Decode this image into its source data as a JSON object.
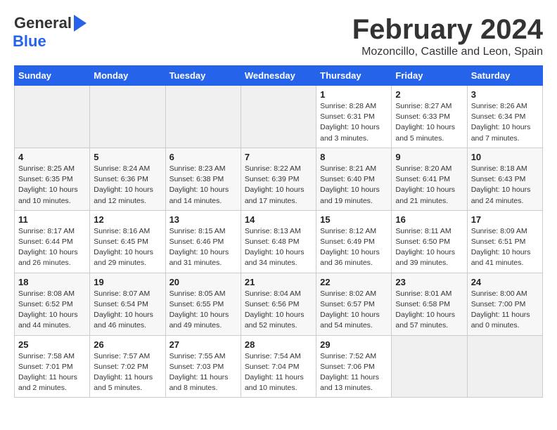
{
  "header": {
    "logo_general": "General",
    "logo_blue": "Blue",
    "month_title": "February 2024",
    "location": "Mozoncillo, Castille and Leon, Spain"
  },
  "days_of_week": [
    "Sunday",
    "Monday",
    "Tuesday",
    "Wednesday",
    "Thursday",
    "Friday",
    "Saturday"
  ],
  "weeks": [
    [
      {
        "day": "",
        "info": ""
      },
      {
        "day": "",
        "info": ""
      },
      {
        "day": "",
        "info": ""
      },
      {
        "day": "",
        "info": ""
      },
      {
        "day": "1",
        "info": "Sunrise: 8:28 AM\nSunset: 6:31 PM\nDaylight: 10 hours\nand 3 minutes."
      },
      {
        "day": "2",
        "info": "Sunrise: 8:27 AM\nSunset: 6:33 PM\nDaylight: 10 hours\nand 5 minutes."
      },
      {
        "day": "3",
        "info": "Sunrise: 8:26 AM\nSunset: 6:34 PM\nDaylight: 10 hours\nand 7 minutes."
      }
    ],
    [
      {
        "day": "4",
        "info": "Sunrise: 8:25 AM\nSunset: 6:35 PM\nDaylight: 10 hours\nand 10 minutes."
      },
      {
        "day": "5",
        "info": "Sunrise: 8:24 AM\nSunset: 6:36 PM\nDaylight: 10 hours\nand 12 minutes."
      },
      {
        "day": "6",
        "info": "Sunrise: 8:23 AM\nSunset: 6:38 PM\nDaylight: 10 hours\nand 14 minutes."
      },
      {
        "day": "7",
        "info": "Sunrise: 8:22 AM\nSunset: 6:39 PM\nDaylight: 10 hours\nand 17 minutes."
      },
      {
        "day": "8",
        "info": "Sunrise: 8:21 AM\nSunset: 6:40 PM\nDaylight: 10 hours\nand 19 minutes."
      },
      {
        "day": "9",
        "info": "Sunrise: 8:20 AM\nSunset: 6:41 PM\nDaylight: 10 hours\nand 21 minutes."
      },
      {
        "day": "10",
        "info": "Sunrise: 8:18 AM\nSunset: 6:43 PM\nDaylight: 10 hours\nand 24 minutes."
      }
    ],
    [
      {
        "day": "11",
        "info": "Sunrise: 8:17 AM\nSunset: 6:44 PM\nDaylight: 10 hours\nand 26 minutes."
      },
      {
        "day": "12",
        "info": "Sunrise: 8:16 AM\nSunset: 6:45 PM\nDaylight: 10 hours\nand 29 minutes."
      },
      {
        "day": "13",
        "info": "Sunrise: 8:15 AM\nSunset: 6:46 PM\nDaylight: 10 hours\nand 31 minutes."
      },
      {
        "day": "14",
        "info": "Sunrise: 8:13 AM\nSunset: 6:48 PM\nDaylight: 10 hours\nand 34 minutes."
      },
      {
        "day": "15",
        "info": "Sunrise: 8:12 AM\nSunset: 6:49 PM\nDaylight: 10 hours\nand 36 minutes."
      },
      {
        "day": "16",
        "info": "Sunrise: 8:11 AM\nSunset: 6:50 PM\nDaylight: 10 hours\nand 39 minutes."
      },
      {
        "day": "17",
        "info": "Sunrise: 8:09 AM\nSunset: 6:51 PM\nDaylight: 10 hours\nand 41 minutes."
      }
    ],
    [
      {
        "day": "18",
        "info": "Sunrise: 8:08 AM\nSunset: 6:52 PM\nDaylight: 10 hours\nand 44 minutes."
      },
      {
        "day": "19",
        "info": "Sunrise: 8:07 AM\nSunset: 6:54 PM\nDaylight: 10 hours\nand 46 minutes."
      },
      {
        "day": "20",
        "info": "Sunrise: 8:05 AM\nSunset: 6:55 PM\nDaylight: 10 hours\nand 49 minutes."
      },
      {
        "day": "21",
        "info": "Sunrise: 8:04 AM\nSunset: 6:56 PM\nDaylight: 10 hours\nand 52 minutes."
      },
      {
        "day": "22",
        "info": "Sunrise: 8:02 AM\nSunset: 6:57 PM\nDaylight: 10 hours\nand 54 minutes."
      },
      {
        "day": "23",
        "info": "Sunrise: 8:01 AM\nSunset: 6:58 PM\nDaylight: 10 hours\nand 57 minutes."
      },
      {
        "day": "24",
        "info": "Sunrise: 8:00 AM\nSunset: 7:00 PM\nDaylight: 11 hours\nand 0 minutes."
      }
    ],
    [
      {
        "day": "25",
        "info": "Sunrise: 7:58 AM\nSunset: 7:01 PM\nDaylight: 11 hours\nand 2 minutes."
      },
      {
        "day": "26",
        "info": "Sunrise: 7:57 AM\nSunset: 7:02 PM\nDaylight: 11 hours\nand 5 minutes."
      },
      {
        "day": "27",
        "info": "Sunrise: 7:55 AM\nSunset: 7:03 PM\nDaylight: 11 hours\nand 8 minutes."
      },
      {
        "day": "28",
        "info": "Sunrise: 7:54 AM\nSunset: 7:04 PM\nDaylight: 11 hours\nand 10 minutes."
      },
      {
        "day": "29",
        "info": "Sunrise: 7:52 AM\nSunset: 7:06 PM\nDaylight: 11 hours\nand 13 minutes."
      },
      {
        "day": "",
        "info": ""
      },
      {
        "day": "",
        "info": ""
      }
    ]
  ]
}
